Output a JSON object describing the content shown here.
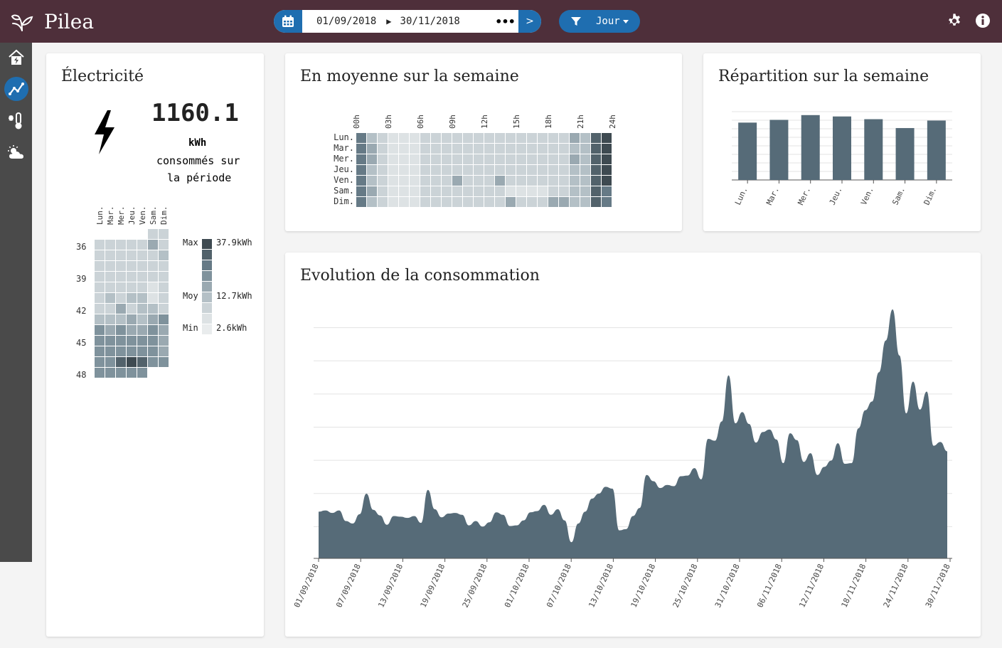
{
  "app": {
    "name": "Pilea"
  },
  "toolbar": {
    "date_start": "01/09/2018",
    "date_end": "30/11/2018",
    "more_label": "•••",
    "next_label": ">",
    "granularity": "Jour"
  },
  "icons": {
    "logo": "plant-logo",
    "calendar": "calendar-icon",
    "filter": "filter-icon",
    "settings": "gear-icon",
    "info": "info-icon"
  },
  "sidebar": {
    "items": [
      {
        "name": "home-energy-icon",
        "active": false
      },
      {
        "name": "chart-icon",
        "active": true
      },
      {
        "name": "thermometer-icon",
        "active": false
      },
      {
        "name": "weather-icon",
        "active": false
      }
    ]
  },
  "electricity": {
    "title": "Électricité",
    "total": "1160.1",
    "unit": "kWh",
    "caption_line1": "consommés sur",
    "caption_line2": "la période",
    "days": [
      "Lun.",
      "Mar.",
      "Mer.",
      "Jeu.",
      "Ven.",
      "Sam.",
      "Dim."
    ],
    "weeks": [
      "36",
      "39",
      "42",
      "45",
      "48"
    ],
    "legend": {
      "max_label": "Max",
      "max_value": "37.9kWh",
      "avg_label": "Moy",
      "avg_value": "12.7kWh",
      "min_label": "Min",
      "min_value": "2.6kWh"
    }
  },
  "weekly_avg": {
    "title": "En moyenne sur la semaine",
    "hours": [
      "00h",
      "03h",
      "06h",
      "09h",
      "12h",
      "15h",
      "18h",
      "21h",
      "24h"
    ],
    "days": [
      "Lun.",
      "Mar.",
      "Mer.",
      "Jeu.",
      "Ven.",
      "Sam.",
      "Dim."
    ]
  },
  "weekly_split": {
    "title": "Répartition sur la semaine",
    "chart_data": {
      "type": "bar",
      "categories": [
        "Lun.",
        "Mar.",
        "Mer.",
        "Jeu.",
        "Ven.",
        "Sam.",
        "Dim."
      ],
      "values": [
        84,
        88,
        95,
        93,
        89,
        76,
        87
      ],
      "ylim": [
        0,
        100
      ],
      "grid": true
    }
  },
  "evolution": {
    "title": "Evolution de la consommation",
    "x_ticks": [
      "01/09/2018",
      "07/09/2018",
      "13/09/2018",
      "19/09/2018",
      "25/09/2018",
      "01/10/2018",
      "07/10/2018",
      "13/10/2018",
      "19/10/2018",
      "25/10/2018",
      "31/10/2018",
      "06/11/2018",
      "12/11/2018",
      "18/11/2018",
      "24/11/2018",
      "30/11/2018"
    ],
    "chart_data": {
      "type": "area",
      "x_start": "01/09/2018",
      "x_end": "30/11/2018",
      "ylim": [
        0,
        40
      ],
      "grid": true,
      "values": [
        7.5,
        7.7,
        7.3,
        7.7,
        6.0,
        5.6,
        7.1,
        10.4,
        7.8,
        6.9,
        5.4,
        6.8,
        6.7,
        6.5,
        6.8,
        5.7,
        11.0,
        7.9,
        6.6,
        7.2,
        7.3,
        7.0,
        5.3,
        6.0,
        5.1,
        5.8,
        7.4,
        7.0,
        5.2,
        5.3,
        6.1,
        7.4,
        7.6,
        8.6,
        7.0,
        7.9,
        6.1,
        2.6,
        5.6,
        7.5,
        9.6,
        10.4,
        11.5,
        11.2,
        4.5,
        4.7,
        6.8,
        8.1,
        13.4,
        12.4,
        11.3,
        11.8,
        11.6,
        13.2,
        13.3,
        14.5,
        12.7,
        19.2,
        18.9,
        22.0,
        29.4,
        21.7,
        23.5,
        21.6,
        18.6,
        20.3,
        20.7,
        19.1,
        15.3,
        20.1,
        19.0,
        15.5,
        16.9,
        13.4,
        14.7,
        15.7,
        18.5,
        15.2,
        15.3,
        20.9,
        23.8,
        25.2,
        29.9,
        35.0,
        40.0,
        32.6,
        23.3,
        28.4,
        23.9,
        26.8,
        18.1,
        18.7,
        17.2
      ]
    }
  }
}
